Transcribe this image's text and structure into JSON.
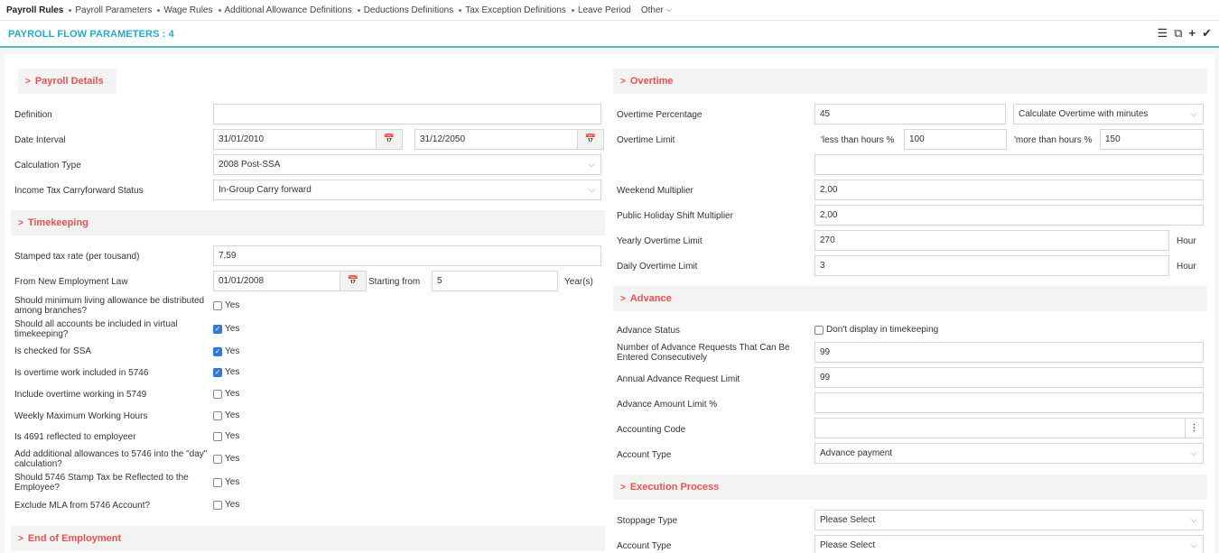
{
  "nav": {
    "items": [
      "Payroll Rules",
      "Payroll Parameters",
      "Wage Rules",
      "Additional Allowance Definitions",
      "Deductions Definitions",
      "Tax Exception Definitions",
      "Leave Period"
    ],
    "other_label": "Other"
  },
  "title": "PAYROLL FLOW PARAMETERS : 4",
  "tools": {
    "list_icon": "☰",
    "copy_icon": "⧉",
    "add_icon": "+",
    "check_icon": "✔"
  },
  "payroll_details": {
    "header": "Payroll Details",
    "definition_label": "Definition",
    "definition_value": "",
    "date_interval_label": "Date Interval",
    "date_start": "31/01/2010",
    "date_end": "31/12/2050",
    "calc_type_label": "Calculation Type",
    "calc_type_value": "2008 Post-SSA",
    "income_tax_label": "Income Tax Carryforward Status",
    "income_tax_value": "In-Group Carry forward"
  },
  "timekeeping": {
    "header": "Timekeeping",
    "stamped_label": "Stamped tax rate (per tousand)",
    "stamped_value": "7,59",
    "new_law_label": "From New Employment Law",
    "new_law_date": "01/01/2008",
    "starting_from_label": "Starting from",
    "starting_from_value": "5",
    "years_unit": "Year(s)",
    "yes_label": "Yes",
    "questions": [
      {
        "label": "Should minimum living allowance be distributed among branches?",
        "checked": false
      },
      {
        "label": "Should all accounts be included in virtual timekeeping?",
        "checked": true
      },
      {
        "label": "Is checked for SSA",
        "checked": true
      },
      {
        "label": "Is overtime work included in 5746",
        "checked": true
      },
      {
        "label": "Include overtime working in 5749",
        "checked": false
      },
      {
        "label": "Weekly Maximum Working Hours",
        "checked": false
      },
      {
        "label": "Is 4691 reflected to employeer",
        "checked": false
      },
      {
        "label": "Add additional allowances to 5746 into the \"day\" calculation?",
        "checked": false
      },
      {
        "label": "Should 5746 Stamp Tax be Reflected to the Employee?",
        "checked": false
      },
      {
        "label": "Exclude MLA from 5746 Account?",
        "checked": false
      }
    ]
  },
  "end_of_employment": {
    "header": "End of Employment"
  },
  "overtime": {
    "header": "Overtime",
    "percentage_label": "Overtime Percentage",
    "percentage_value": "45",
    "calc_mode_value": "Calculate Overtime with minutes",
    "limit_label": "Overtime Limit",
    "less_than_label": "'less than hours %",
    "less_than_value": "100",
    "more_than_label": "'more than hours %",
    "more_than_value": "150",
    "extra_value": "",
    "weekend_label": "Weekend Multiplier",
    "weekend_value": "2,00",
    "holiday_label": "Public Holiday Shift Multiplier",
    "holiday_value": "2,00",
    "yearly_label": "Yearly Overtime Limit",
    "yearly_value": "270",
    "daily_label": "Daily Overtime Limit",
    "daily_value": "3",
    "hour_unit": "Hour"
  },
  "advance": {
    "header": "Advance",
    "status_label": "Advance Status",
    "status_checkbox_label": "Don't display in timekeeping",
    "consecutive_label": "Number of Advance Requests That Can Be Entered Consecutively",
    "consecutive_value": "99",
    "annual_label": "Annual Advance Request Limit",
    "annual_value": "99",
    "amount_limit_label": "Advance Amount Limit %",
    "amount_limit_value": "",
    "accounting_code_label": "Accounting Code",
    "accounting_code_value": "",
    "account_type_label": "Account Type",
    "account_type_value": "Advance payment"
  },
  "execution": {
    "header": "Execution Process",
    "stoppage_label": "Stoppage Type",
    "stoppage_value": "Please Select",
    "account_type_label": "Account Type",
    "account_type_value": "Please Select"
  }
}
